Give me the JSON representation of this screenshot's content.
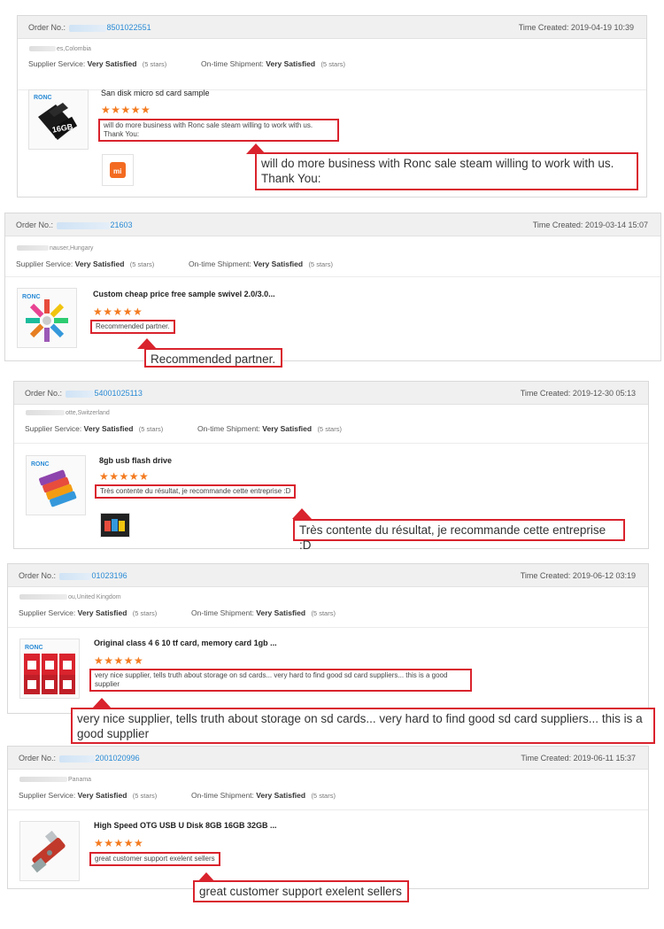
{
  "reviews": [
    {
      "order_label": "Order No.:",
      "order_no": "8501022551",
      "time_created": "Time Created: 2019-04-19 10:39",
      "country": "es,Colombia",
      "supplier_service_label": "Supplier Service:",
      "supplier_service_value": "Very Satisfied",
      "supplier_service_stars": "(5 stars)",
      "shipment_label": "On-time Shipment:",
      "shipment_value": "Very Satisfied",
      "shipment_stars": "(5 stars)",
      "product_title": "San disk micro sd card sample",
      "rating": "★★★★★",
      "review_text": "will do more business with Ronc sale steam willing to work with us. Thank You:",
      "callout_text": "will do more business with Ronc sale steam willing to work with us. Thank You:",
      "brand": "RONC",
      "card_label": "16GB",
      "extra_image_label": "mi"
    },
    {
      "order_label": "Order No.:",
      "order_no": "21603",
      "time_created": "Time Created: 2019-03-14 15:07",
      "country": "nauser,Hungary",
      "supplier_service_label": "Supplier Service:",
      "supplier_service_value": "Very Satisfied",
      "supplier_service_stars": "(5 stars)",
      "shipment_label": "On-time Shipment:",
      "shipment_value": "Very Satisfied",
      "shipment_stars": "(5 stars)",
      "product_title": "Custom cheap price free sample swivel 2.0/3.0...",
      "rating": "★★★★★",
      "review_text": "Recommended partner.",
      "callout_text": "Recommended partner.",
      "brand": "RONC"
    },
    {
      "order_label": "Order No.:",
      "order_no": "54001025113",
      "time_created": "Time Created: 2019-12-30 05:13",
      "country": "otte,Switzerland",
      "supplier_service_label": "Supplier Service:",
      "supplier_service_value": "Very Satisfied",
      "supplier_service_stars": "(5 stars)",
      "shipment_label": "On-time Shipment:",
      "shipment_value": "Very Satisfied",
      "shipment_stars": "(5 stars)",
      "product_title": "8gb usb flash drive",
      "rating": "★★★★★",
      "review_text": "Très contente du résultat, je recommande cette entreprise :D",
      "callout_text": "Très contente du résultat, je recommande cette entreprise :D",
      "brand": "RONC"
    },
    {
      "order_label": "Order No.:",
      "order_no": "01023196",
      "time_created": "Time Created: 2019-06-12 03:19",
      "country": "ou,United Kingdom",
      "supplier_service_label": "Supplier Service:",
      "supplier_service_value": "Very Satisfied",
      "supplier_service_stars": "(5 stars)",
      "shipment_label": "On-time Shipment:",
      "shipment_value": "Very Satisfied",
      "shipment_stars": "(5 stars)",
      "product_title": "Original class 4 6 10 tf card, memory card 1gb ...",
      "rating": "★★★★★",
      "review_text": "very nice supplier, tells truth about storage on sd cards... very hard to find good sd card suppliers... this is a good supplier",
      "callout_text": "very nice supplier, tells truth about storage on sd cards... very hard to find good sd card suppliers... this is a good supplier",
      "brand": "RONC"
    },
    {
      "order_label": "Order No.:",
      "order_no": "2001020996",
      "time_created": "Time Created: 2019-06-11 15:37",
      "country": "Panama",
      "supplier_service_label": "Supplier Service:",
      "supplier_service_value": "Very Satisfied",
      "supplier_service_stars": "(5 stars)",
      "shipment_label": "On-time Shipment:",
      "shipment_value": "Very Satisfied",
      "shipment_stars": "(5 stars)",
      "product_title": "High Speed OTG USB U Disk 8GB 16GB 32GB ...",
      "rating": "★★★★★",
      "review_text": "great customer support exelent sellers",
      "callout_text": "great customer support exelent sellers"
    }
  ],
  "colors": {
    "accent_red": "#d9232d",
    "star_orange": "#f47b20",
    "link_blue": "#2a8bd6",
    "header_gray": "#f0f0f0"
  },
  "icons": [
    "usb-drive-icon",
    "sd-card-icon",
    "xiaomi-logo-icon",
    "star-icon"
  ]
}
